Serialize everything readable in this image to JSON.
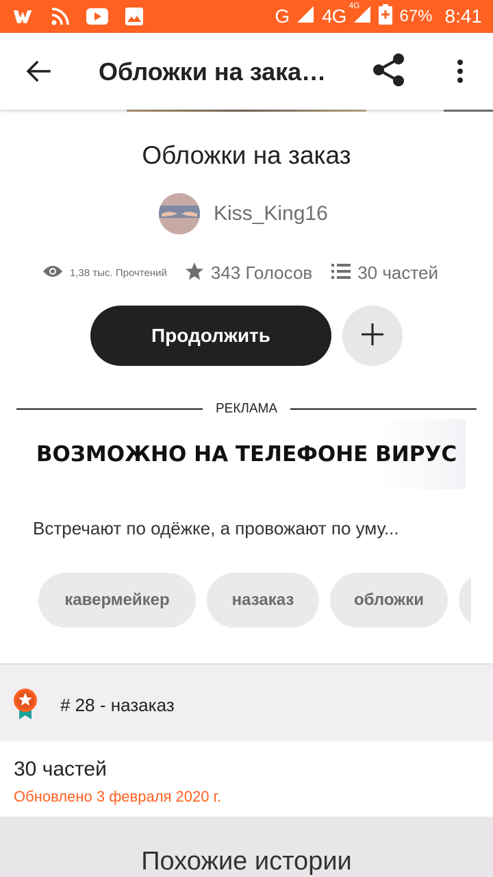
{
  "status_bar": {
    "network_g": "G",
    "network_4g": "4G",
    "network_4g_small": "4G",
    "battery": "67%",
    "time": "8:41",
    "icons": [
      "wattpad-icon",
      "rss-icon",
      "youtube-icon",
      "image-icon",
      "signal-icon",
      "battery-icon"
    ],
    "bg_color": "#ff6122"
  },
  "app_bar": {
    "title": "Обложки на зака…",
    "back_icon": "arrow-left-icon",
    "share_icon": "share-icon",
    "more_icon": "more-vert-icon"
  },
  "story": {
    "title": "Обложки на заказ",
    "author": "Kiss_King16",
    "reads": "1,38 тыс. Прочтений",
    "votes": "343 Голосов",
    "parts": "30 частей",
    "continue_label": "Продолжить",
    "description": "Встречают по одёжке, а провожают по уму..."
  },
  "ad": {
    "label": "РЕКЛАМА",
    "banner_text": "ВОЗМОЖНО НА ТЕЛЕФОНЕ ВИРУС"
  },
  "tags": [
    "кавермейкер",
    "назаказ",
    "обложки"
  ],
  "ranking": {
    "text": "# 28 - назаказ"
  },
  "parts_section": {
    "title": "30 частей",
    "updated": "Обновлено 3 февраля 2020 г."
  },
  "similar": {
    "title": "Похожие истории"
  },
  "colors": {
    "accent": "#ff6122",
    "button_dark": "#222022",
    "tag_bg": "#ebe9ec"
  }
}
